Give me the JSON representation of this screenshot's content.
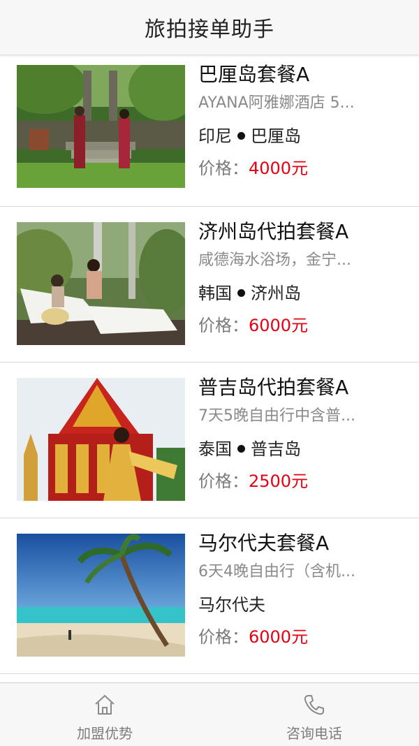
{
  "header": {
    "title": "旅拍接单助手"
  },
  "packages": [
    {
      "name": "巴厘岛套餐A",
      "desc": "AYANA阿雅娜酒店 5...",
      "country": "印尼",
      "city": "巴厘岛",
      "price_label": "价格：",
      "price": "4000元",
      "image": "bali-couple-temple-photo"
    },
    {
      "name": "济州岛代拍套餐A",
      "desc": "咸德海水浴场，金宁...",
      "country": "韩国",
      "city": "济州岛",
      "price_label": "价格：",
      "price": "6000元",
      "image": "jeju-couple-loungers-photo"
    },
    {
      "name": "普吉岛代拍套餐A",
      "desc": "7天5晚自由行中含普...",
      "country": "泰国",
      "city": "普吉岛",
      "price_label": "价格：",
      "price": "2500元",
      "image": "phuket-temple-bride-photo"
    },
    {
      "name": "马尔代夫套餐A",
      "desc": "6天4晚自由行（含机...",
      "location": "马尔代夫",
      "price_label": "价格：",
      "price": "6000元",
      "image": "maldives-beach-palm-photo"
    }
  ],
  "tabbar": {
    "tabs": [
      {
        "label": "加盟优势",
        "icon": "home-icon"
      },
      {
        "label": "咨询电话",
        "icon": "phone-icon"
      }
    ]
  },
  "colors": {
    "price": "#e60012",
    "header_bg": "#f7f7f7"
  }
}
